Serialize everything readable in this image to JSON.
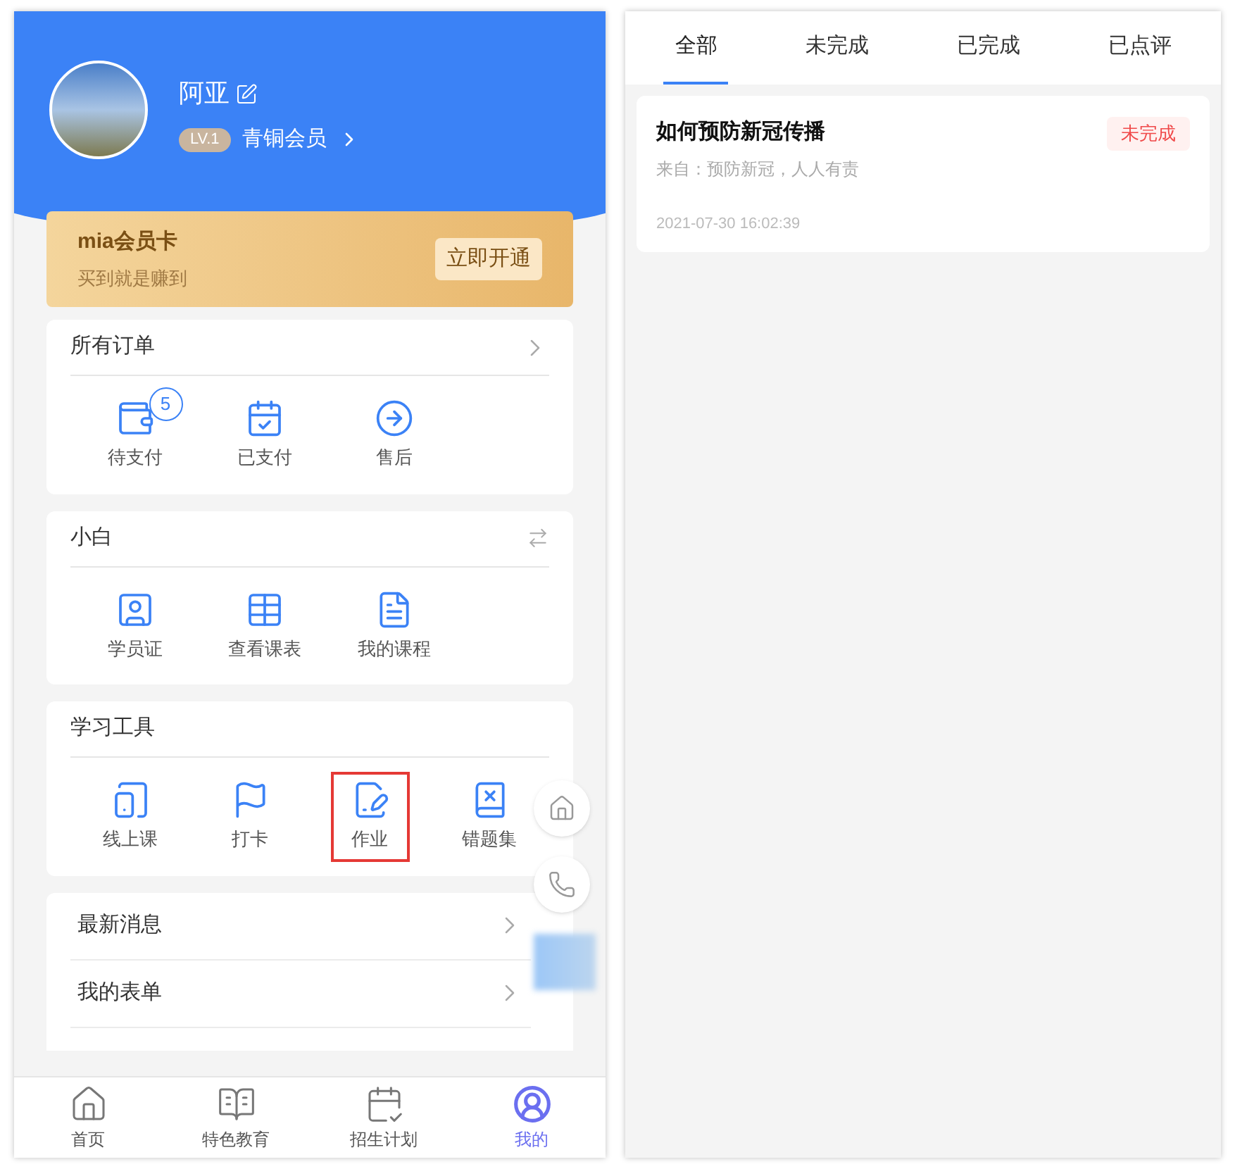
{
  "profile": {
    "name": "阿亚",
    "level": "LV.1",
    "membership": "青铜会员"
  },
  "member_card": {
    "title": "mia会员卡",
    "subtitle": "买到就是赚到",
    "button": "立即开通"
  },
  "sections": [
    {
      "title": "所有订单",
      "kind": "chevron",
      "items": [
        {
          "label": "待支付",
          "badge": "5",
          "highlighted": false
        },
        {
          "label": "已支付",
          "highlighted": false
        },
        {
          "label": "售后",
          "highlighted": false
        }
      ]
    },
    {
      "title": "小白",
      "kind": "switch",
      "items": [
        {
          "label": "学员证",
          "highlighted": false
        },
        {
          "label": "查看课表",
          "highlighted": false
        },
        {
          "label": "我的课程",
          "highlighted": false
        }
      ]
    },
    {
      "title": "学习工具",
      "kind": "plain",
      "items": [
        {
          "label": "线上课",
          "highlighted": false
        },
        {
          "label": "打卡",
          "highlighted": false
        },
        {
          "label": "作业",
          "highlighted": true
        },
        {
          "label": "错题集",
          "highlighted": false
        }
      ]
    }
  ],
  "menu": [
    {
      "label": "最新消息"
    },
    {
      "label": "我的表单"
    }
  ],
  "tab_bar": [
    {
      "label": "首页",
      "selected": false
    },
    {
      "label": "特色教育",
      "selected": false
    },
    {
      "label": "招生计划",
      "selected": false
    },
    {
      "label": "我的",
      "selected": true
    }
  ],
  "task_tabs": [
    {
      "label": "全部",
      "selected": true
    },
    {
      "label": "未完成",
      "selected": false
    },
    {
      "label": "已完成",
      "selected": false
    },
    {
      "label": "已点评",
      "selected": false
    }
  ],
  "tasks": [
    {
      "title": "如何预防新冠传播",
      "source": "来自：预防新冠，人人有责",
      "time": "2021-07-30 16:02:39",
      "status": "未完成"
    }
  ]
}
